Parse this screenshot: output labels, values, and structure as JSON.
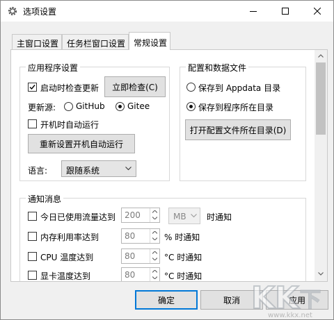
{
  "window": {
    "title": "选项设置",
    "icon": "gear-icon"
  },
  "tabs": [
    {
      "label": "主窗口设置",
      "selected": false
    },
    {
      "label": "任务栏窗口设置",
      "selected": false
    },
    {
      "label": "常规设置",
      "selected": true
    }
  ],
  "app_settings": {
    "title": "应用程序设置",
    "check_update_label": "启动时检查更新",
    "check_update_checked": true,
    "check_now_label": "立即检查(C)",
    "source_label": "更新源:",
    "source_github": "GitHub",
    "source_gitee": "Gitee",
    "source_selected": "Gitee",
    "autorun_label": "开机时自动运行",
    "autorun_checked": false,
    "reset_autorun_label": "重新设置开机自动运行",
    "language_label": "语言:",
    "language_value": "跟随系统"
  },
  "config_files": {
    "title": "配置和数据文件",
    "appdata_label": "保存到 Appdata 目录",
    "program_dir_label": "保存到程序所在目录",
    "selected": "program_dir",
    "open_dir_label": "打开配置文件所在目录(D)"
  },
  "notifications": {
    "title": "通知消息",
    "rows": [
      {
        "label": "今日已使用流量达到",
        "value": "200",
        "unit_select": "MB",
        "suffix": "时通知"
      },
      {
        "label": "内存利用率达到",
        "value": "80",
        "suffix": "% 时通知"
      },
      {
        "label": "CPU 温度达到",
        "value": "80",
        "suffix": "°C 时通知"
      },
      {
        "label": "显卡温度达到",
        "value": "80",
        "suffix": "°C 时通知"
      }
    ]
  },
  "buttons": {
    "ok": "确定",
    "cancel": "取消",
    "apply": "应用"
  },
  "watermark": {
    "text": "www.kkx.net"
  },
  "colors": {
    "focus_border": "#0078d7",
    "button_face": "#e1e1e1",
    "watermark": "#b8b8b8"
  }
}
